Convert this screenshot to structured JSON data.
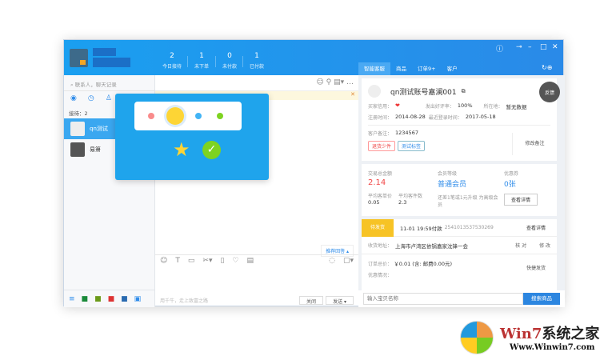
{
  "header": {
    "stats": [
      {
        "n": "2",
        "l": "今日接待"
      },
      {
        "n": "1",
        "l": "未下单"
      },
      {
        "n": "0",
        "l": "未付款"
      },
      {
        "n": "1",
        "l": "已付款"
      }
    ]
  },
  "right_tabs": [
    "智能客服",
    "商品",
    "订单9+",
    "客户"
  ],
  "left": {
    "search_placeholder": "联系人，聊天记录",
    "count": "接待：2",
    "contacts": [
      {
        "name": "qn测试"
      },
      {
        "name": "易箫"
      }
    ]
  },
  "mid": {
    "recommend": "推荐回答 ▴",
    "hint": "用千牛，走上致富之路",
    "close": "关闭",
    "send": "发送 ▾"
  },
  "customer": {
    "name": "qn测试账号嘉澜001",
    "feedback": "反馈",
    "credit_label": "买家信用：",
    "credit": "❤",
    "rating_label": "发出好评率：",
    "rating": "100%",
    "location_label": "所在地：",
    "location": "暂无数据",
    "reg_label": "注册时间：",
    "reg": "2014-08-28",
    "login_label": "最近登录时间：",
    "login": "2017-05-18",
    "note_label": "客户备注：",
    "note": "1234567",
    "tags": [
      "退货少件",
      "测试标签"
    ],
    "edit_note": "修改备注",
    "total_label": "交易总金额",
    "total": "2.14",
    "avg_price_label": "平均客单价",
    "avg_price": "0.05",
    "avg_items_label": "平均客件数",
    "avg_items": "2.3",
    "level_label": "会员等级",
    "level": "普通会员",
    "upgrade": "还差1笔或1元升级 为高级会员",
    "coupon_label": "优惠券",
    "coupon": "0张",
    "details": "查看详情"
  },
  "order": {
    "status": "待发货",
    "time": "11-01 19:59付款",
    "id": "2541013537530269",
    "details": "查看详情",
    "addr_label": "收货地址：",
    "addr": "上海市卢湾区依锅嘉家沈锋一会",
    "check": "核 对",
    "modify": "修 改",
    "total_label": "订单总价：",
    "total": "￥0.01 (含: 邮费0.00元)",
    "discount_label": "优惠情况：",
    "ship": "快捷发货"
  },
  "product_search": {
    "placeholder": "输入宝贝名称",
    "button": "搜索商品"
  },
  "watermark": {
    "brand": "Win7系统之家",
    "url": "Www.Winwin7.com"
  }
}
